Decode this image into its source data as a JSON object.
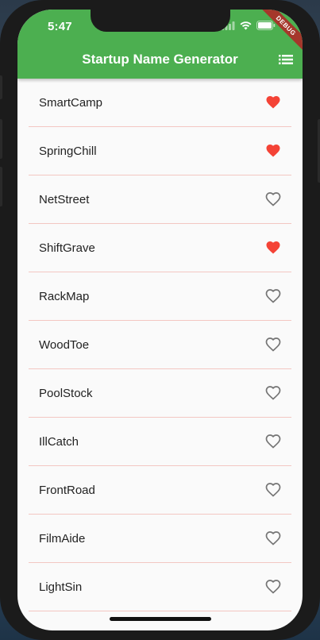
{
  "status_bar": {
    "time": "5:47"
  },
  "debug_banner": "DEBUG",
  "app_bar": {
    "title": "Startup Name Generator",
    "background": "#4caf50",
    "action_icon": "list-icon"
  },
  "colors": {
    "favorite": "#f44336",
    "not_favorite": "#757575",
    "divider": "#f3c7c2"
  },
  "names": [
    {
      "label": "SmartCamp",
      "favorite": true
    },
    {
      "label": "SpringChill",
      "favorite": true
    },
    {
      "label": "NetStreet",
      "favorite": false
    },
    {
      "label": "ShiftGrave",
      "favorite": true
    },
    {
      "label": "RackMap",
      "favorite": false
    },
    {
      "label": "WoodToe",
      "favorite": false
    },
    {
      "label": "PoolStock",
      "favorite": false
    },
    {
      "label": "IllCatch",
      "favorite": false
    },
    {
      "label": "FrontRoad",
      "favorite": false
    },
    {
      "label": "FilmAide",
      "favorite": false
    },
    {
      "label": "LightSin",
      "favorite": false
    }
  ]
}
